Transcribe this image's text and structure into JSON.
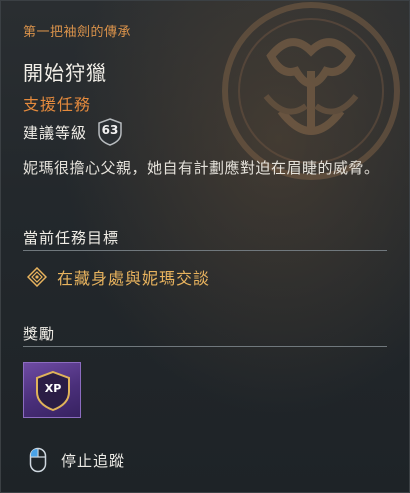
{
  "quest": {
    "questline": "第一把袖劍的傳承",
    "title": "開始狩獵",
    "type": "支援任務",
    "recommended_label": "建議等級",
    "recommended_level": "63",
    "description": "妮瑪很擔心父親，她自有計劃應對迫在眉睫的威脅。"
  },
  "objectives": {
    "heading": "當前任務目標",
    "current": "在藏身處與妮瑪交談",
    "icon": "objective-diamond-icon"
  },
  "rewards": {
    "heading": "獎勵",
    "items": [
      {
        "label": "XP",
        "icon": "xp-shield-icon"
      }
    ]
  },
  "actions": {
    "stop_tracking": "停止追蹤",
    "stop_tracking_icon": "mouse-icon"
  },
  "colors": {
    "accent_orange": "#e48a3d",
    "objective_gold": "#e8b35e",
    "reward_purple": "#5b3b8f"
  }
}
